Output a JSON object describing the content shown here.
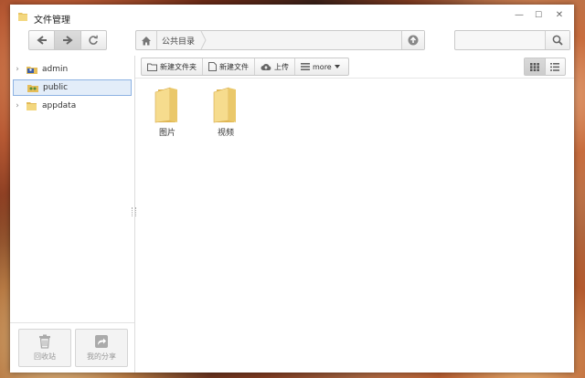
{
  "window": {
    "title": "文件管理",
    "controls": {
      "minimize": "—",
      "maximize": "☐",
      "close": "✕"
    }
  },
  "path": {
    "current": "公共目录"
  },
  "search": {
    "value": "",
    "placeholder": ""
  },
  "sidebar": {
    "items": [
      {
        "label": "admin",
        "icon": "user-folder-icon",
        "selected": false
      },
      {
        "label": "public",
        "icon": "shared-folder-icon",
        "selected": true
      },
      {
        "label": "appdata",
        "icon": "folder-icon",
        "selected": false
      }
    ],
    "bottom": {
      "recycle_label": "回收站",
      "share_label": "我的分享"
    }
  },
  "actions": {
    "new_folder": "新建文件夹",
    "new_file": "新建文件",
    "upload": "上传",
    "more": "more"
  },
  "view": {
    "mode": "grid"
  },
  "files": [
    {
      "name": "图片",
      "icon": "folder-icon"
    },
    {
      "name": "视频",
      "icon": "folder-icon"
    }
  ],
  "colors": {
    "selection_bg": "#e3edf9",
    "selection_border": "#8db2e3",
    "folder_light": "#f6dc8e",
    "folder_dark": "#e2b956"
  }
}
